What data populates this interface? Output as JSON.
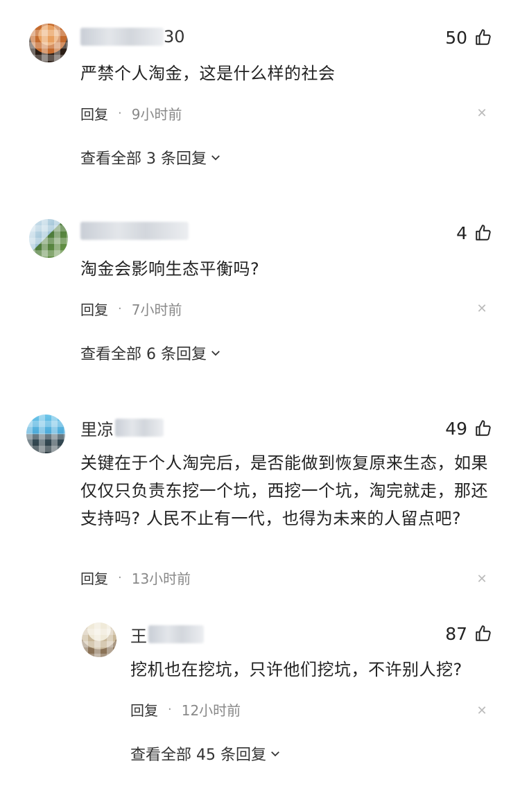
{
  "comments": [
    {
      "name_visible": "30",
      "likes": "50",
      "content": "严禁个人淘金，这是什么样的社会",
      "reply_label": "回复",
      "time": "9小时前",
      "view_all": "查看全部 3 条回复"
    },
    {
      "name_visible": "",
      "likes": "4",
      "content": "淘金会影响生态平衡吗?",
      "reply_label": "回复",
      "time": "7小时前",
      "view_all": "查看全部 6 条回复"
    },
    {
      "name_visible": "里凉",
      "likes": "49",
      "content": "关键在于个人淘完后，是否能做到恢复原来生态，如果仅仅只负责东挖一个坑，西挖一个坑，淘完就走，那还支持吗? 人民不止有一代，也得为未来的人留点吧?",
      "reply_label": "回复",
      "time": "13小时前"
    }
  ],
  "reply": {
    "name_visible": "王",
    "likes": "87",
    "content": "挖机也在挖坑，只许他们挖坑，不许别人挖?",
    "reply_label": "回复",
    "time": "12小时前",
    "view_all": "查看全部 45 条回复"
  },
  "icons": {
    "like": "thumbs-up-icon",
    "close": "close-icon",
    "expand": "chevron-down-icon"
  }
}
